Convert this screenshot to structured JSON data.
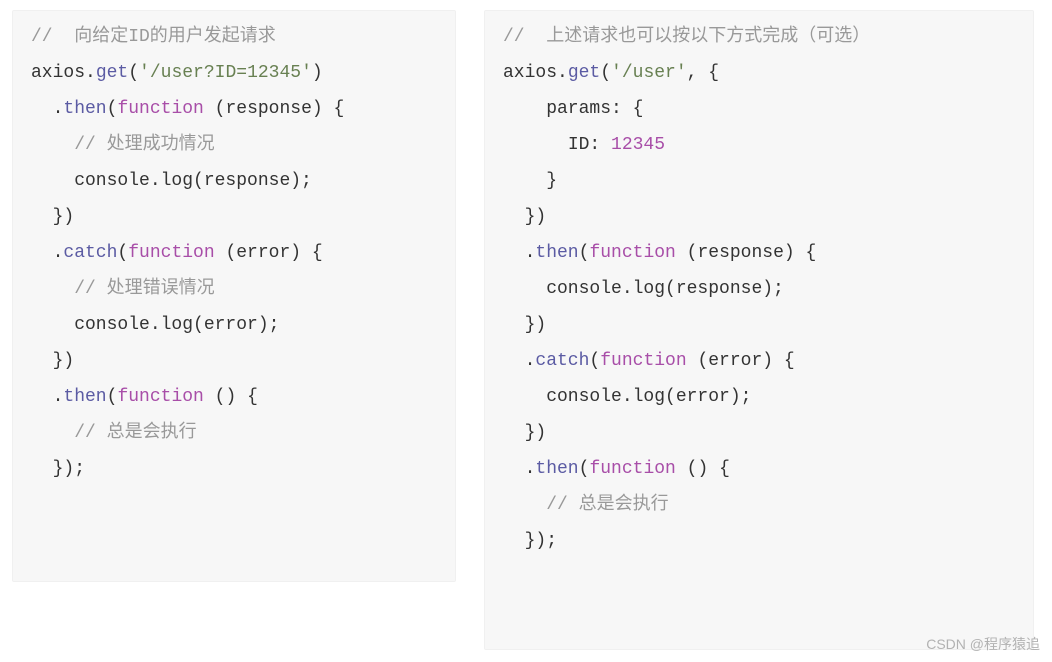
{
  "left": {
    "c1": "//  向给定ID的用户发起请求",
    "l2": {
      "obj": "axios",
      "dot": ".",
      "m": "get",
      "open": "(",
      "arg": "'/user?ID=12345'",
      "close": ")"
    },
    "l3": {
      "dot": "  .",
      "m": "then",
      "open": "(",
      "kw": "function",
      "paren": " (response) {"
    },
    "c4": "    // 处理成功情况",
    "l5": "    console.log(response);",
    "l6": "  })",
    "l7": {
      "dot": "  .",
      "m": "catch",
      "open": "(",
      "kw": "function",
      "paren": " (error) {"
    },
    "c8": "    // 处理错误情况",
    "l9": "    console.log(error);",
    "l10": "  })",
    "l11": {
      "dot": "  .",
      "m": "then",
      "open": "(",
      "kw": "function",
      "paren": " () {"
    },
    "c12": "    // 总是会执行",
    "l13": "  });"
  },
  "right": {
    "c1": "//  上述请求也可以按以下方式完成（可选）",
    "l2": {
      "obj": "axios",
      "dot": ".",
      "m": "get",
      "open": "(",
      "arg": "'/user'",
      "close": ", {"
    },
    "l3": "    params: {",
    "l4": {
      "indent": "      ",
      "key": "ID",
      "colon": ": ",
      "val": "12345"
    },
    "l5": "    }",
    "l6": "  })",
    "l7": {
      "dot": "  .",
      "m": "then",
      "open": "(",
      "kw": "function",
      "paren": " (response) {"
    },
    "l8": "    console.log(response);",
    "l9": "  })",
    "l10": {
      "dot": "  .",
      "m": "catch",
      "open": "(",
      "kw": "function",
      "paren": " (error) {"
    },
    "l11": "    console.log(error);",
    "l12": "  })",
    "l13": {
      "dot": "  .",
      "m": "then",
      "open": "(",
      "kw": "function",
      "paren": " () {"
    },
    "c14": "    // 总是会执行",
    "l15": "  });"
  },
  "watermark": "CSDN @程序猿追"
}
